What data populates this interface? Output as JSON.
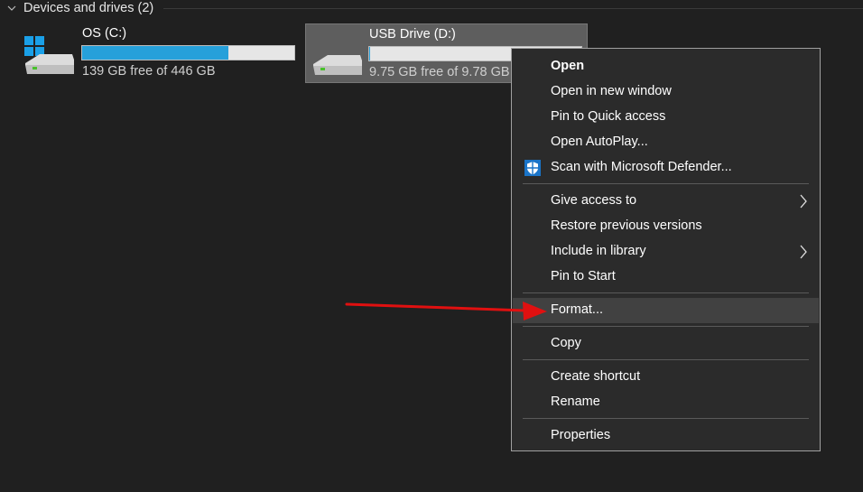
{
  "group": {
    "title": "Devices and drives (2)"
  },
  "drives": [
    {
      "name": "OS (C:)",
      "free_text": "139 GB free of 446 GB",
      "used_fraction": 0.69,
      "bar_color": "#26a0da",
      "icon": "windows-drive-icon"
    },
    {
      "name": "USB Drive (D:)",
      "free_text": "9.75 GB free of 9.78 GB",
      "used_fraction": 0.003,
      "bar_color": "#26a0da",
      "icon": "usb-drive-icon",
      "selected": true
    }
  ],
  "context_menu": {
    "items": [
      {
        "label": "Open",
        "bold": true
      },
      {
        "label": "Open in new window"
      },
      {
        "label": "Pin to Quick access"
      },
      {
        "label": "Open AutoPlay..."
      },
      {
        "label": "Scan with Microsoft Defender...",
        "icon": "defender-shield-icon"
      },
      {
        "label": "Give access to",
        "submenu": true
      },
      {
        "label": "Restore previous versions"
      },
      {
        "label": "Include in library",
        "submenu": true
      },
      {
        "label": "Pin to Start"
      },
      {
        "label": "Format...",
        "highlighted": true
      },
      {
        "label": "Copy"
      },
      {
        "label": "Create shortcut"
      },
      {
        "label": "Rename"
      },
      {
        "label": "Properties"
      }
    ]
  },
  "annotation": {
    "arrow_color": "#e01010"
  }
}
